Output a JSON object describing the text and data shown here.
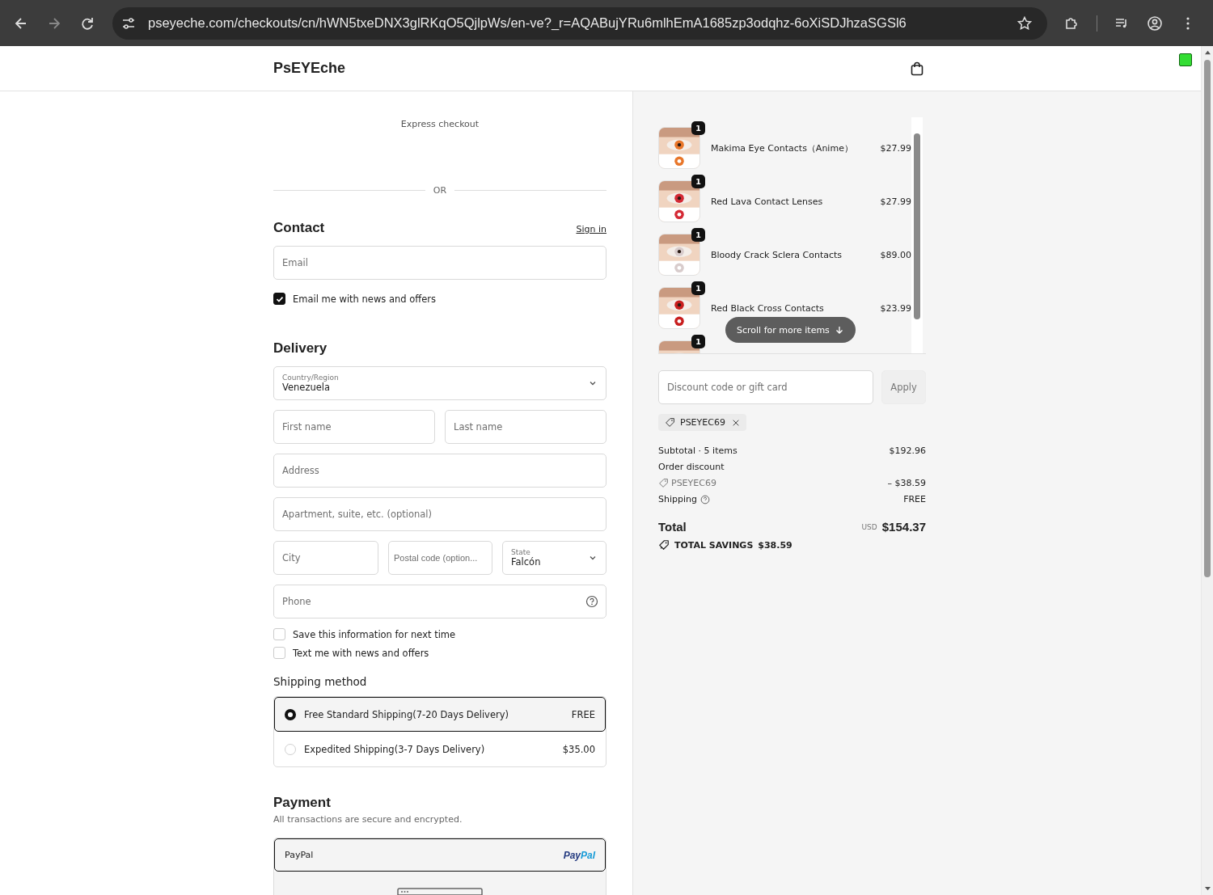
{
  "browser": {
    "url": "pseyeche.com/checkouts/cn/hWN5txeDNX3glRKqO5QjlpWs/en-ve?_r=AQABujYRu6mlhEmA1685zp3odqhz-6oXiSDJhzaSGSl6"
  },
  "header": {
    "logo": "PsEYEche"
  },
  "express": {
    "label": "Express checkout",
    "divider": "OR"
  },
  "contact": {
    "title": "Contact",
    "sign_in": "Sign in",
    "email": {
      "placeholder": "Email"
    },
    "news": {
      "label": "Email me with news and offers",
      "checked": true
    }
  },
  "delivery": {
    "title": "Delivery",
    "country": {
      "label": "Country/Region",
      "value": "Venezuela"
    },
    "first_name": {
      "placeholder": "First name"
    },
    "last_name": {
      "placeholder": "Last name"
    },
    "address": {
      "placeholder": "Address"
    },
    "apartment": {
      "placeholder": "Apartment, suite, etc. (optional)"
    },
    "city": {
      "placeholder": "City"
    },
    "postal": {
      "placeholder": "Postal code (option..."
    },
    "state": {
      "label": "State",
      "value": "Falcón"
    },
    "phone": {
      "placeholder": "Phone"
    }
  },
  "options": [
    {
      "label": "Save this information for next time",
      "checked": false
    },
    {
      "label": "Text me with news and offers",
      "checked": false
    }
  ],
  "shipping": {
    "title": "Shipping method",
    "methods": [
      {
        "label": "Free Standard Shipping(7-20 Days Delivery)",
        "price": "FREE",
        "selected": true
      },
      {
        "label": "Expedited Shipping(3-7 Days Delivery)",
        "price": "$35.00",
        "selected": false
      }
    ]
  },
  "payment": {
    "title": "Payment",
    "note": "All transactions are secure and encrypted.",
    "methods": [
      {
        "label": "PayPal",
        "logo_parts": [
          "Pay",
          "Pal"
        ],
        "selected": true
      }
    ]
  },
  "cart": {
    "items": [
      {
        "name": "Makima Eye Contacts（Anime）",
        "price": "$27.99",
        "quantity": "1"
      },
      {
        "name": "Red Lava Contact Lenses",
        "price": "$27.99",
        "quantity": "1"
      },
      {
        "name": "Bloody Crack Sclera Contacts",
        "price": "$89.00",
        "quantity": "1"
      },
      {
        "name": "Red Black Cross Contacts",
        "price": "$23.99",
        "quantity": "1"
      },
      {
        "quantity": "1"
      }
    ],
    "scroll_hint": "Scroll for more items"
  },
  "discount": {
    "placeholder": "Discount code or gift card",
    "button": "Apply",
    "applied": "PSEYEC69"
  },
  "summary": {
    "subtotal_label": "Subtotal · 5 items",
    "subtotal": "$192.96",
    "discount_label": "Order discount",
    "discount_code": "PSEYEC69",
    "discount_amount": "– $38.59",
    "shipping_label": "Shipping",
    "shipping": "FREE",
    "total_label": "Total",
    "currency": "USD",
    "total": "$154.37",
    "savings_label": "TOTAL SAVINGS",
    "savings": "$38.59"
  }
}
